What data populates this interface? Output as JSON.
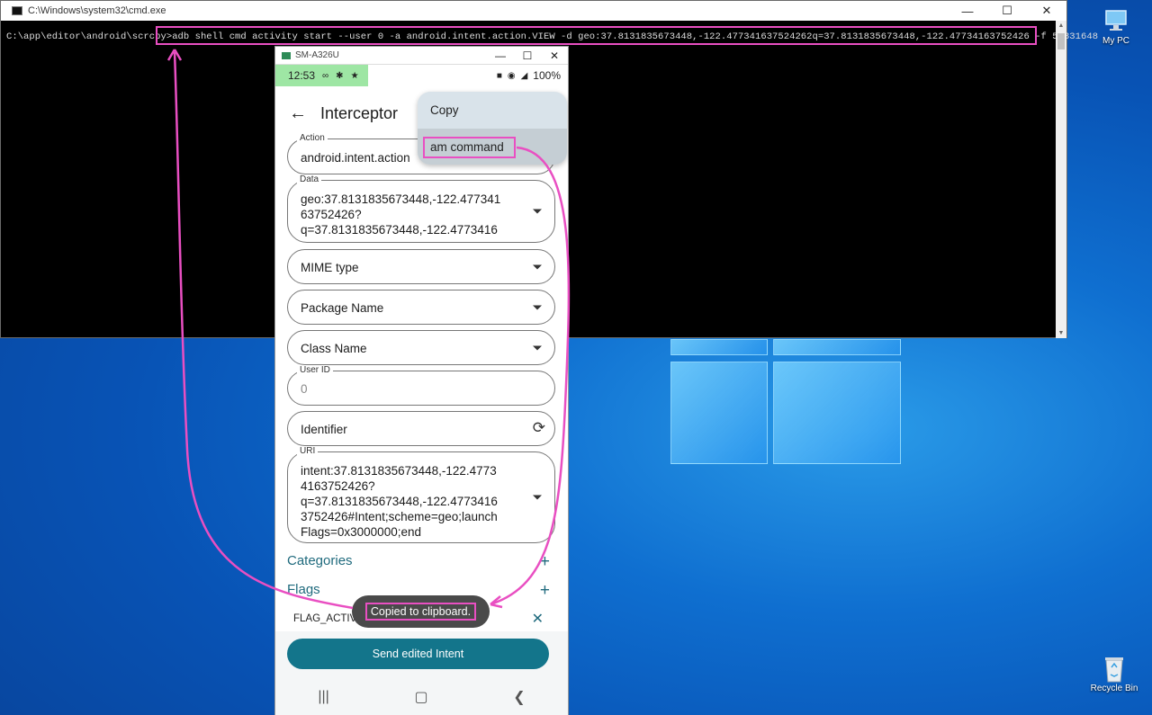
{
  "desktop": {
    "icons": [
      {
        "label": "My PC",
        "icon": "pc-icon"
      },
      {
        "label": "Recycle Bin",
        "icon": "recycle-bin-icon"
      }
    ]
  },
  "cmd_window": {
    "title": "C:\\Windows\\system32\\cmd.exe",
    "prompt": "C:\\app\\editor\\android\\scrcpy>",
    "command": "adb shell cmd activity start --user 0 -a android.intent.action.VIEW -d geo:37.8131835673448,-122.477341637524262q=37.8131835673448,-122.47734163752426 -f 50331648"
  },
  "phone_window": {
    "title": "SM-A326U",
    "status": {
      "time": "12:53",
      "battery": "100%"
    },
    "app_title": "Interceptor",
    "fields": {
      "action": {
        "label": "Action",
        "value": "android.intent.action"
      },
      "data": {
        "label": "Data",
        "value_lines": [
          "geo:37.8131835673448,-122.477341",
          "63752426?",
          "q=37.8131835673448,-122.4773416"
        ]
      },
      "mime": {
        "placeholder": "MIME type"
      },
      "package": {
        "placeholder": "Package Name"
      },
      "class": {
        "placeholder": "Class Name"
      },
      "user_id": {
        "label": "User ID",
        "placeholder": "0"
      },
      "identifier": {
        "placeholder": "Identifier"
      },
      "uri": {
        "label": "URI",
        "value_lines": [
          "intent:37.8131835673448,-122.4773",
          "4163752426?",
          "q=37.8131835673448,-122.4773416",
          "3752426#Intent;scheme=geo;launch",
          "Flags=0x3000000;end"
        ]
      }
    },
    "sections": {
      "categories": "Categories",
      "flags": "Flags"
    },
    "flag_item": "FLAG_ACTIV",
    "send_button": "Send edited Intent",
    "menu": {
      "items": [
        "Copy",
        "am command"
      ]
    },
    "toast": "Copied to clipboard."
  },
  "colors": {
    "highlight": "#e94fc2",
    "accent": "#13758b"
  }
}
